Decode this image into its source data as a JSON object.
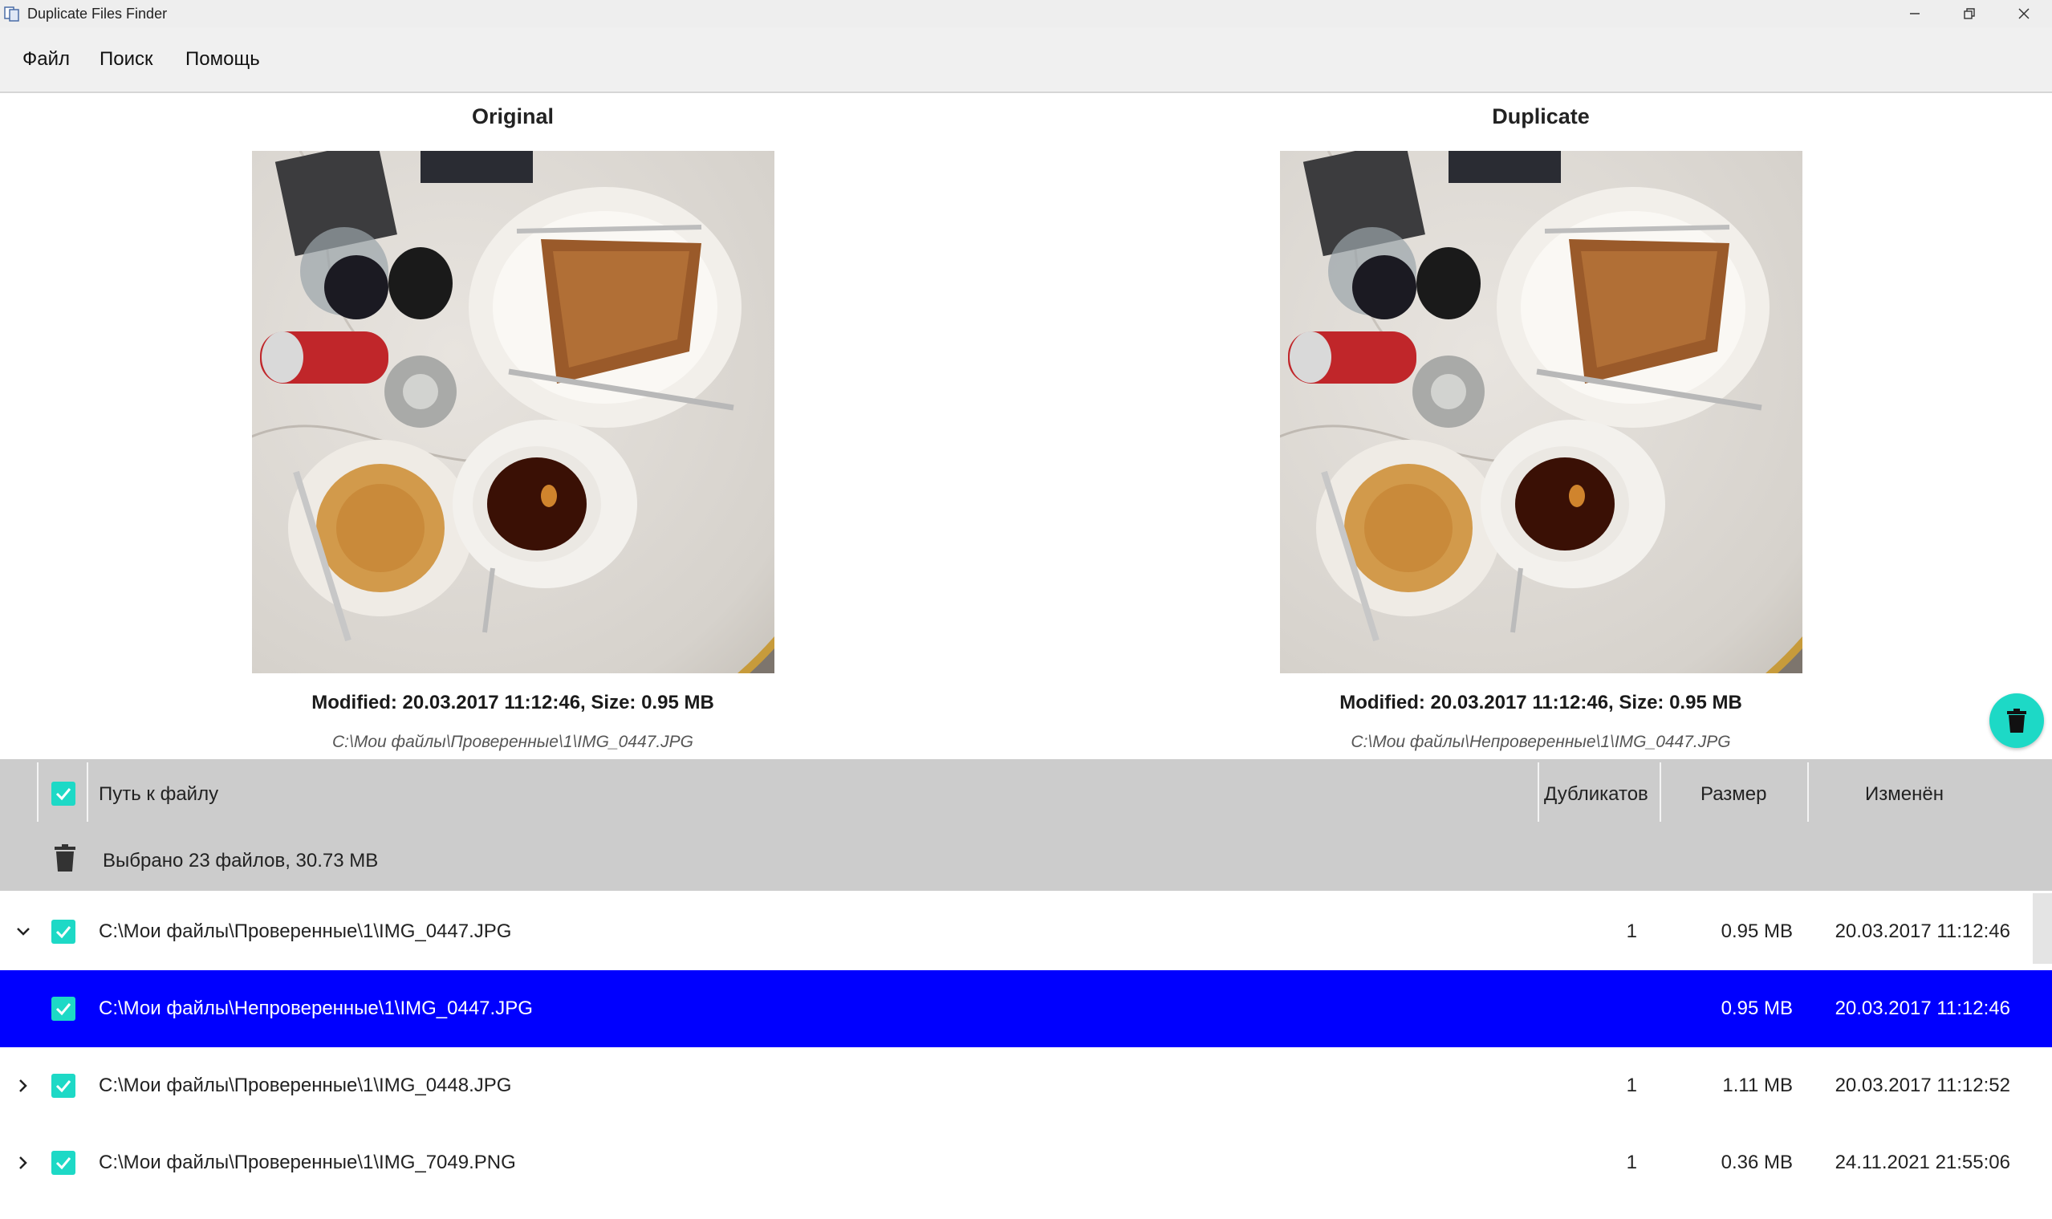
{
  "window": {
    "title": "Duplicate Files Finder",
    "icon": "app-logo-icon",
    "controls": [
      "minimize-icon",
      "restore-icon",
      "close-icon"
    ]
  },
  "menu": {
    "file": "Файл",
    "search": "Поиск",
    "help": "Помощь"
  },
  "preview": {
    "original": {
      "title": "Original",
      "meta": "Modified: 20.03.2017 11:12:46, Size: 0.95 MB",
      "path": "C:\\Мои файлы\\Проверенные\\1\\IMG_0447.JPG"
    },
    "duplicate": {
      "title": "Duplicate",
      "meta": "Modified: 20.03.2017 11:12:46, Size: 0.95 MB",
      "path": "C:\\Мои файлы\\Непроверенные\\1\\IMG_0447.JPG"
    },
    "delete_button_icon": "trash-icon",
    "accent_color": "#1dd9c6"
  },
  "table": {
    "columns": {
      "path": "Путь к файлу",
      "duplicates": "Дубликатов",
      "size": "Размер",
      "modified": "Изменён"
    },
    "summary": "Выбрано 23 файлов, 30.73 MB",
    "rows": [
      {
        "expander": "chevron-down-icon",
        "checked": true,
        "path": "C:\\Мои файлы\\Проверенные\\1\\IMG_0447.JPG",
        "duplicates": "1",
        "size": "0.95 MB",
        "modified": "20.03.2017 11:12:46"
      },
      {
        "expander": "",
        "checked": true,
        "selected": true,
        "path": "C:\\Мои файлы\\Непроверенные\\1\\IMG_0447.JPG",
        "duplicates": "",
        "size": "0.95 MB",
        "modified": "20.03.2017 11:12:46"
      },
      {
        "expander": "chevron-right-icon",
        "checked": true,
        "path": "C:\\Мои файлы\\Проверенные\\1\\IMG_0448.JPG",
        "duplicates": "1",
        "size": "1.11 MB",
        "modified": "20.03.2017 11:12:52"
      },
      {
        "expander": "chevron-right-icon",
        "checked": true,
        "path": "C:\\Мои файлы\\Проверенные\\1\\IMG_7049.PNG",
        "duplicates": "1",
        "size": "0.36 MB",
        "modified": "24.11.2021 21:55:06"
      }
    ],
    "selected_row_color": "#0000ff"
  }
}
